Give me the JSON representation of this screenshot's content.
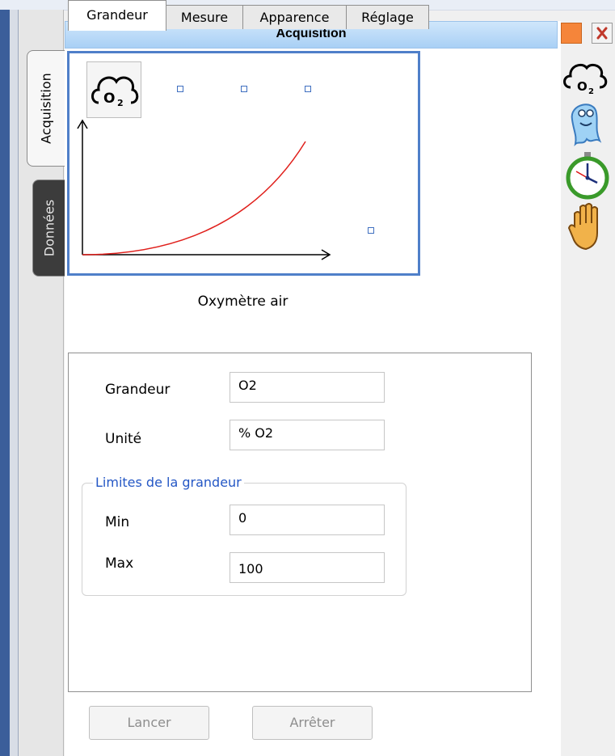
{
  "window": {
    "title": "Acquisition"
  },
  "vertical_tabs": [
    {
      "label": "Acquisition",
      "active": true
    },
    {
      "label": "Données",
      "active": false
    }
  ],
  "sensor": {
    "name": "Oxymètre air",
    "icon": "o2-cloud-icon"
  },
  "tabs": [
    {
      "label": "Grandeur",
      "active": true
    },
    {
      "label": "Mesure",
      "active": false
    },
    {
      "label": "Apparence",
      "active": false
    },
    {
      "label": "Réglage",
      "active": false
    }
  ],
  "fields": {
    "grandeur": {
      "label": "Grandeur",
      "value": "O2"
    },
    "unite": {
      "label": "Unité",
      "value": "% O2"
    }
  },
  "limits": {
    "title": "Limites de la grandeur",
    "min": {
      "label": "Min",
      "value": "0"
    },
    "max": {
      "label": "Max",
      "value": "100"
    }
  },
  "buttons": {
    "start": "Lancer",
    "stop": "Arrêter"
  },
  "toolbar_icons": [
    "o2-cloud-icon",
    "ghost-icon",
    "timer-icon",
    "hand-stop-icon"
  ],
  "colors": {
    "accent": "#4f7fc9",
    "curve": "#e0201c",
    "group_title": "#2457c5",
    "title_bar": "#a9d0f5"
  }
}
